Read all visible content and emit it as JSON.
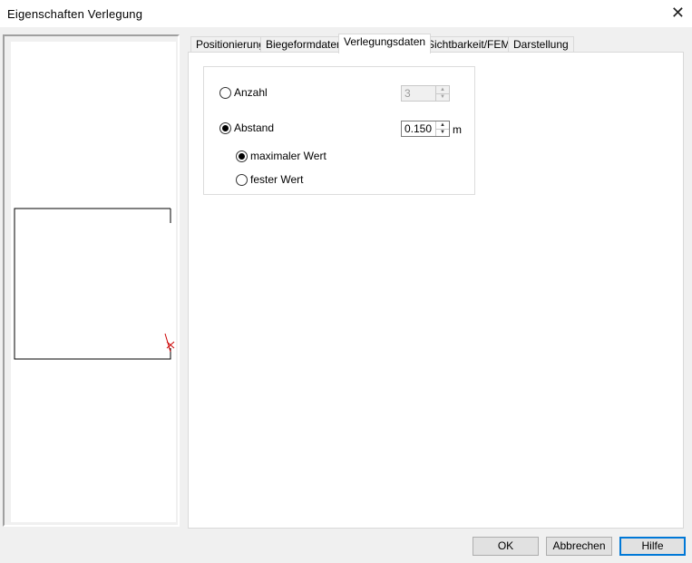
{
  "window": {
    "title": "Eigenschaften Verlegung",
    "close_glyph": "✕"
  },
  "tabs": [
    {
      "label": "Positionierung",
      "active": false
    },
    {
      "label": "Biegeformdaten",
      "active": false
    },
    {
      "label": "Verlegungsdaten",
      "active": true
    },
    {
      "label": "Sichtbarkeit/FEM",
      "active": false
    },
    {
      "label": "Darstellung",
      "active": false
    }
  ],
  "verlegungsdaten": {
    "anzahl": {
      "label": "Anzahl",
      "checked": false,
      "value": "3",
      "enabled": false
    },
    "abstand": {
      "label": "Abstand",
      "checked": true,
      "value": "0.150",
      "unit": "m"
    },
    "maximaler_wert": {
      "label": "maximaler Wert",
      "checked": true
    },
    "fester_wert": {
      "label": "fester Wert",
      "checked": false
    }
  },
  "buttons": {
    "ok": "OK",
    "abbrechen": "Abbrechen",
    "hilfe": "Hilfe"
  },
  "colors": {
    "accent": "#0078d7",
    "preview_marker": "#cc0000"
  }
}
